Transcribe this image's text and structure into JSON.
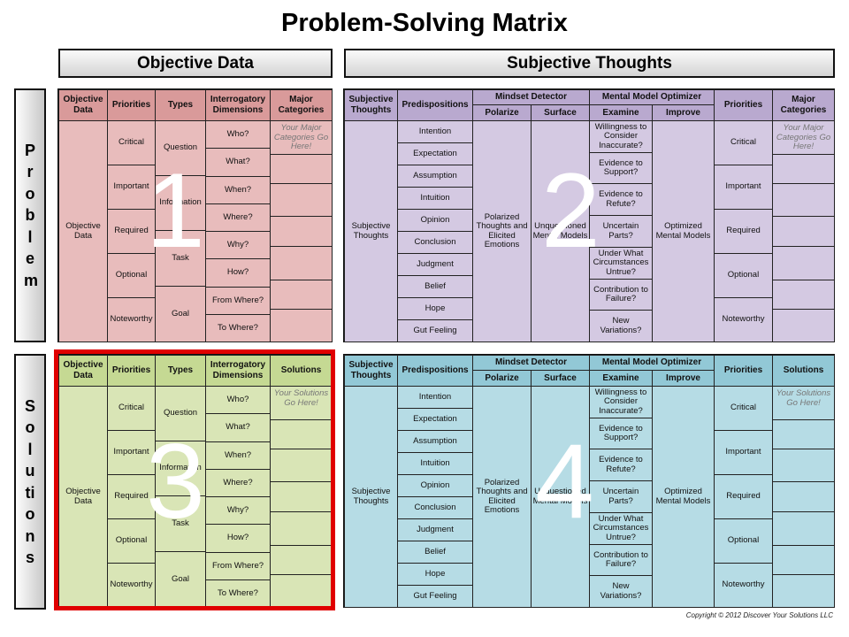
{
  "title": "Problem-Solving Matrix",
  "headers": {
    "objective": "Objective Data",
    "subjective": "Subjective Thoughts"
  },
  "side": {
    "problem": "Problem",
    "solutions": "Solutions"
  },
  "copyright": "Copyright © 2012 Discover Your Solutions LLC",
  "quadrants": {
    "q1": {
      "number": "1",
      "colors": {
        "header": "#d99a9a",
        "body": "#e8bcbc"
      },
      "headers": [
        "Objective Data",
        "Priorities",
        "Types",
        "Interrogatory Dimensions",
        "Major Categories"
      ],
      "first_col": "Objective Data",
      "priorities": [
        "Critical",
        "Important",
        "Required",
        "Optional",
        "Noteworthy"
      ],
      "types": [
        "Question",
        "Information",
        "Task",
        "Goal"
      ],
      "dimensions": [
        "Who?",
        "What?",
        "When?",
        "Where?",
        "Why?",
        "How?",
        "From Where?",
        "To Where?"
      ],
      "placeholder": "Your Major Categories Go Here!"
    },
    "q2": {
      "number": "2",
      "colors": {
        "header": "#b9a9cf",
        "body": "#d4c9e2"
      },
      "headers": [
        "Subjective Thoughts",
        "Predispositions",
        "Mindset Detector",
        "Polarize",
        "Surface",
        "Mental Model Optimizer",
        "Examine",
        "Improve",
        "Priorities",
        "Major Categories"
      ],
      "first_col": "Subjective Thoughts",
      "predispositions": [
        "Intention",
        "Expectation",
        "Assumption",
        "Intuition",
        "Opinion",
        "Conclusion",
        "Judgment",
        "Belief",
        "Hope",
        "Gut Feeling"
      ],
      "polarize": "Polarized Thoughts and Elicited Emotions",
      "surface": "Unquestioned Mental Models",
      "examine": [
        "Willingness to Consider Inaccurate?",
        "Evidence to Support?",
        "Evidence to Refute?",
        "Uncertain Parts?",
        "Under What Circumstances Untrue?",
        "Contribution to Failure?",
        "New Variations?"
      ],
      "improve": "Optimized Mental Models",
      "priorities": [
        "Critical",
        "Important",
        "Required",
        "Optional",
        "Noteworthy"
      ],
      "placeholder": "Your Major Categories Go Here!"
    },
    "q3": {
      "number": "3",
      "colors": {
        "header": "#c5d993",
        "body": "#d9e5b6",
        "highlight": "#e00000"
      },
      "headers": [
        "Objective Data",
        "Priorities",
        "Types",
        "Interrogatory Dimensions",
        "Solutions"
      ],
      "first_col": "Objective Data",
      "priorities": [
        "Critical",
        "Important",
        "Required",
        "Optional",
        "Noteworthy"
      ],
      "types": [
        "Question",
        "Information",
        "Task",
        "Goal"
      ],
      "dimensions": [
        "Who?",
        "What?",
        "When?",
        "Where?",
        "Why?",
        "How?",
        "From Where?",
        "To Where?"
      ],
      "placeholder": "Your Solutions Go Here!"
    },
    "q4": {
      "number": "4",
      "colors": {
        "header": "#92c8d6",
        "body": "#b6dce5"
      },
      "headers": [
        "Subjective Thoughts",
        "Predispositions",
        "Mindset Detector",
        "Polarize",
        "Surface",
        "Mental Model Optimizer",
        "Examine",
        "Improve",
        "Priorities",
        "Solutions"
      ],
      "first_col": "Subjective Thoughts",
      "predispositions": [
        "Intention",
        "Expectation",
        "Assumption",
        "Intuition",
        "Opinion",
        "Conclusion",
        "Judgment",
        "Belief",
        "Hope",
        "Gut Feeling"
      ],
      "polarize": "Polarized Thoughts and Elicited Emotions",
      "surface": "Unquestioned Mental Models",
      "examine": [
        "Willingness to Consider Inaccurate?",
        "Evidence to Support?",
        "Evidence to Refute?",
        "Uncertain Parts?",
        "Under What Circumstances Untrue?",
        "Contribution to Failure?",
        "New Variations?"
      ],
      "improve": "Optimized Mental Models",
      "priorities": [
        "Critical",
        "Important",
        "Required",
        "Optional",
        "Noteworthy"
      ],
      "placeholder": "Your Solutions Go Here!"
    }
  }
}
